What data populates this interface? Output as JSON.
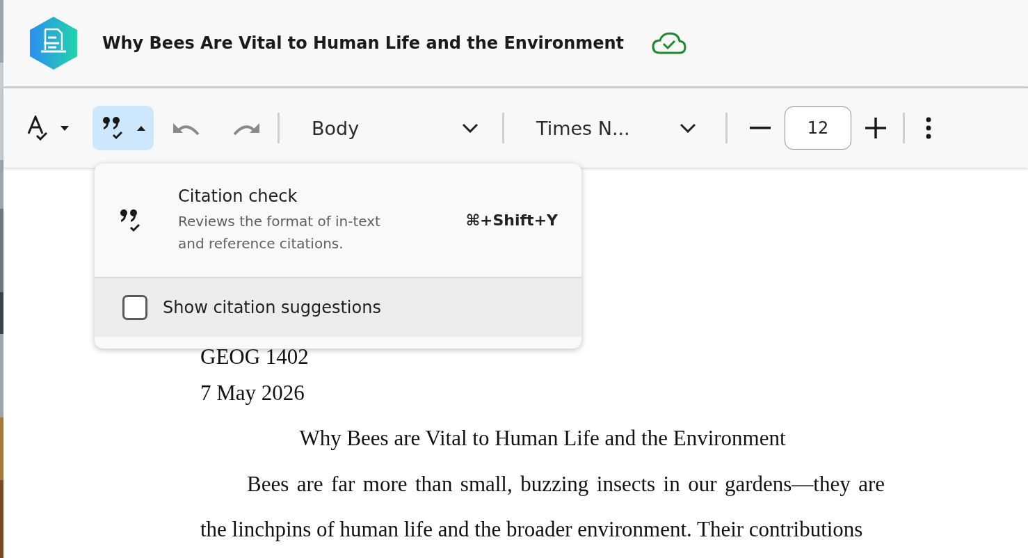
{
  "header": {
    "title": "Why Bees Are Vital to Human Life and the Environment",
    "saved": true
  },
  "toolbar": {
    "spellcheck": {
      "expanded": false
    },
    "citation": {
      "expanded": true
    },
    "paragraph_style": {
      "value": "Body"
    },
    "font": {
      "value": "Times N..."
    },
    "font_size": {
      "value": "12"
    }
  },
  "citation_menu": {
    "title": "Citation check",
    "description": "Reviews the format of in-text and reference citations.",
    "shortcut": "⌘+Shift+Y",
    "option": {
      "label": "Show citation suggestions",
      "checked": false
    }
  },
  "document": {
    "lines": [
      {
        "kind": "plain",
        "text": "GEOG 1402"
      },
      {
        "kind": "plain",
        "text": "7 May 2026"
      },
      {
        "kind": "title",
        "text": "Why Bees are Vital to Human Life and the Environment"
      },
      {
        "kind": "paragraph",
        "text": "Bees are far more than small, buzzing insects in our gardens—they are the linchpins of human life and the broader environment. Their contributions"
      }
    ]
  }
}
